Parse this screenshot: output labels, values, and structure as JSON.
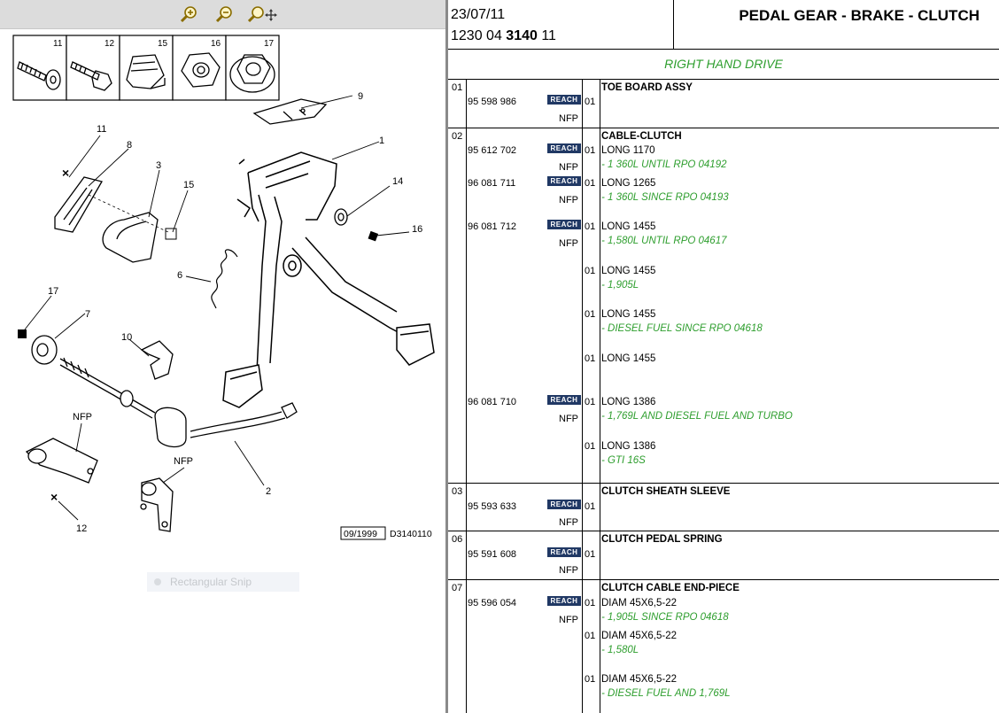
{
  "toolbar": {
    "zoom_in_icon": "zoom-in-icon",
    "zoom_out_icon": "zoom-out-icon",
    "zoom_pan_icon": "zoom-pan-icon"
  },
  "diagram": {
    "callouts": {
      "c1": "1",
      "c2": "2",
      "c3": "3",
      "c6": "6",
      "c7": "7",
      "c8": "8",
      "c9": "9",
      "c10": "10",
      "c11": "11",
      "c12": "12",
      "c14": "14",
      "c15": "15",
      "c16": "16",
      "c17": "17"
    },
    "thumbs": [
      "11",
      "12",
      "15",
      "16",
      "17"
    ],
    "nfp_a": "NFP",
    "nfp_b": "NFP",
    "date_stamp": "09/1999",
    "ref_code": "D3140110",
    "snip_label": "Rectangular Snip"
  },
  "header": {
    "date": "23/07/11",
    "ref_prefix": "1230 04",
    "ref_bold": "3140",
    "ref_suffix": "11",
    "title": "PEDAL GEAR - BRAKE - CLUTCH",
    "drive_label": "RIGHT HAND DRIVE"
  },
  "sections": [
    {
      "num": "01",
      "title": "TOE BOARD ASSY",
      "parts": [
        {
          "pn": "95 598 986",
          "reach": "REACH",
          "nfp": "NFP",
          "qty": "01"
        }
      ],
      "variants": []
    },
    {
      "num": "02",
      "title": "CABLE-CLUTCH",
      "parts": [
        {
          "pn": "95 612 702",
          "reach": "REACH",
          "nfp": "NFP"
        },
        {
          "pn": "96 081 711",
          "reach": "REACH",
          "nfp": "NFP"
        },
        {
          "pn": "96 081 712",
          "reach": "REACH",
          "nfp": "NFP"
        },
        {
          "pn": "96 081 710",
          "reach": "REACH",
          "nfp": "NFP"
        }
      ],
      "variants": [
        {
          "qty": "01",
          "desc": "LONG 1170",
          "note": "- 1 360L UNTIL RPO 04192"
        },
        {
          "qty": "01",
          "desc": "LONG 1265",
          "note": "- 1 360L SINCE RPO 04193"
        },
        {
          "qty": "01",
          "desc": "LONG 1455",
          "note": "- 1,580L UNTIL RPO 04617"
        },
        {
          "qty": "01",
          "desc": "LONG 1455",
          "note": "- 1,905L"
        },
        {
          "qty": "01",
          "desc": "LONG 1455",
          "note": "- DIESEL FUEL SINCE RPO 04618"
        },
        {
          "qty": "01",
          "desc": "LONG 1455",
          "note": ""
        },
        {
          "qty": "01",
          "desc": "LONG 1386",
          "note": "- 1,769L AND DIESEL FUEL AND TURBO"
        },
        {
          "qty": "01",
          "desc": "LONG 1386",
          "note": "- GTI 16S"
        }
      ]
    },
    {
      "num": "03",
      "title": "CLUTCH SHEATH SLEEVE",
      "parts": [
        {
          "pn": "95 593 633",
          "reach": "REACH",
          "nfp": "NFP",
          "qty": "01"
        }
      ],
      "variants": []
    },
    {
      "num": "06",
      "title": "CLUTCH PEDAL SPRING",
      "parts": [
        {
          "pn": "95 591 608",
          "reach": "REACH",
          "nfp": "NFP",
          "qty": "01"
        }
      ],
      "variants": []
    },
    {
      "num": "07",
      "title": "CLUTCH CABLE END-PIECE",
      "parts": [
        {
          "pn": "95 596 054",
          "reach": "REACH",
          "nfp": "NFP"
        }
      ],
      "variants": [
        {
          "qty": "01",
          "desc": "DIAM 45X6,5-22",
          "note": "- 1,905L SINCE RPO 04618"
        },
        {
          "qty": "01",
          "desc": "DIAM 45X6,5-22",
          "note": "- 1,580L"
        },
        {
          "qty": "01",
          "desc": "DIAM 45X6,5-22",
          "note": "- DIESEL FUEL AND 1,769L"
        }
      ]
    }
  ]
}
